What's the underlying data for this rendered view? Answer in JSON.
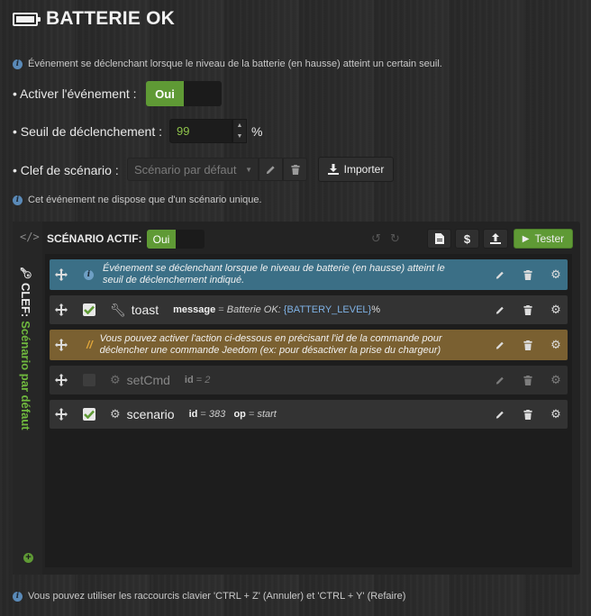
{
  "header": {
    "title": "BATTERIE OK",
    "icon": "battery-full-icon"
  },
  "info_top": "Événement se déclenchant lorsque le niveau de la batterie (en hausse) atteint un certain seuil.",
  "activate": {
    "label": "• Activer l'événement :",
    "on_label": "Oui"
  },
  "threshold": {
    "label": "• Seuil de déclenchement :",
    "value": "99",
    "unit": "%"
  },
  "scenario_key": {
    "label": "• Clef de scénario :",
    "selected": "Scénario par défaut",
    "import_label": "Importer"
  },
  "info_unique": "Cet événement ne dispose que d'un scénario unique.",
  "panel": {
    "active_label": "SCÉNARIO ACTIF:",
    "active_toggle": "Oui",
    "test_label": "Tester",
    "dollar": "$",
    "vertical_key_prefix": "CLEF:",
    "vertical_key_name": "Scénario par défaut"
  },
  "rows": [
    {
      "type": "comment-info",
      "text": "Événement se déclenchant lorsque le niveau de batterie (en hausse) atteint le seuil de déclenchement indiqué."
    },
    {
      "type": "action",
      "enabled": true,
      "name": "toast",
      "icon": "wrench-icon",
      "k1": "message",
      "sep": "=",
      "v1a": "Batterie OK: ",
      "var": "{BATTERY_LEVEL}",
      "v1b": "%"
    },
    {
      "type": "comment-note",
      "text": "Vous pouvez activer l'action ci-dessous en précisant l'id de la commande pour déclencher une commande Jeedom (ex: pour désactiver la prise du chargeur)"
    },
    {
      "type": "action",
      "enabled": false,
      "name": "setCmd",
      "icon": "robot-icon",
      "k1": "id",
      "sep": "=",
      "v1": "2"
    },
    {
      "type": "action",
      "enabled": true,
      "name": "scenario",
      "icon": "robot-icon",
      "k1": "id",
      "sep": "=",
      "v1": "383",
      "k2": "op",
      "v2": "start"
    }
  ],
  "footer_info": "Vous pouvez utiliser les raccourcis clavier 'CTRL + Z' (Annuler) et 'CTRL + Y' (Refaire)",
  "colors": {
    "toggle_on": "#5f9a35",
    "test_button": "#5f9a35",
    "comment_blue": "#3b6f86",
    "comment_brown": "#7a6031",
    "accent_green": "#8ec24a"
  }
}
